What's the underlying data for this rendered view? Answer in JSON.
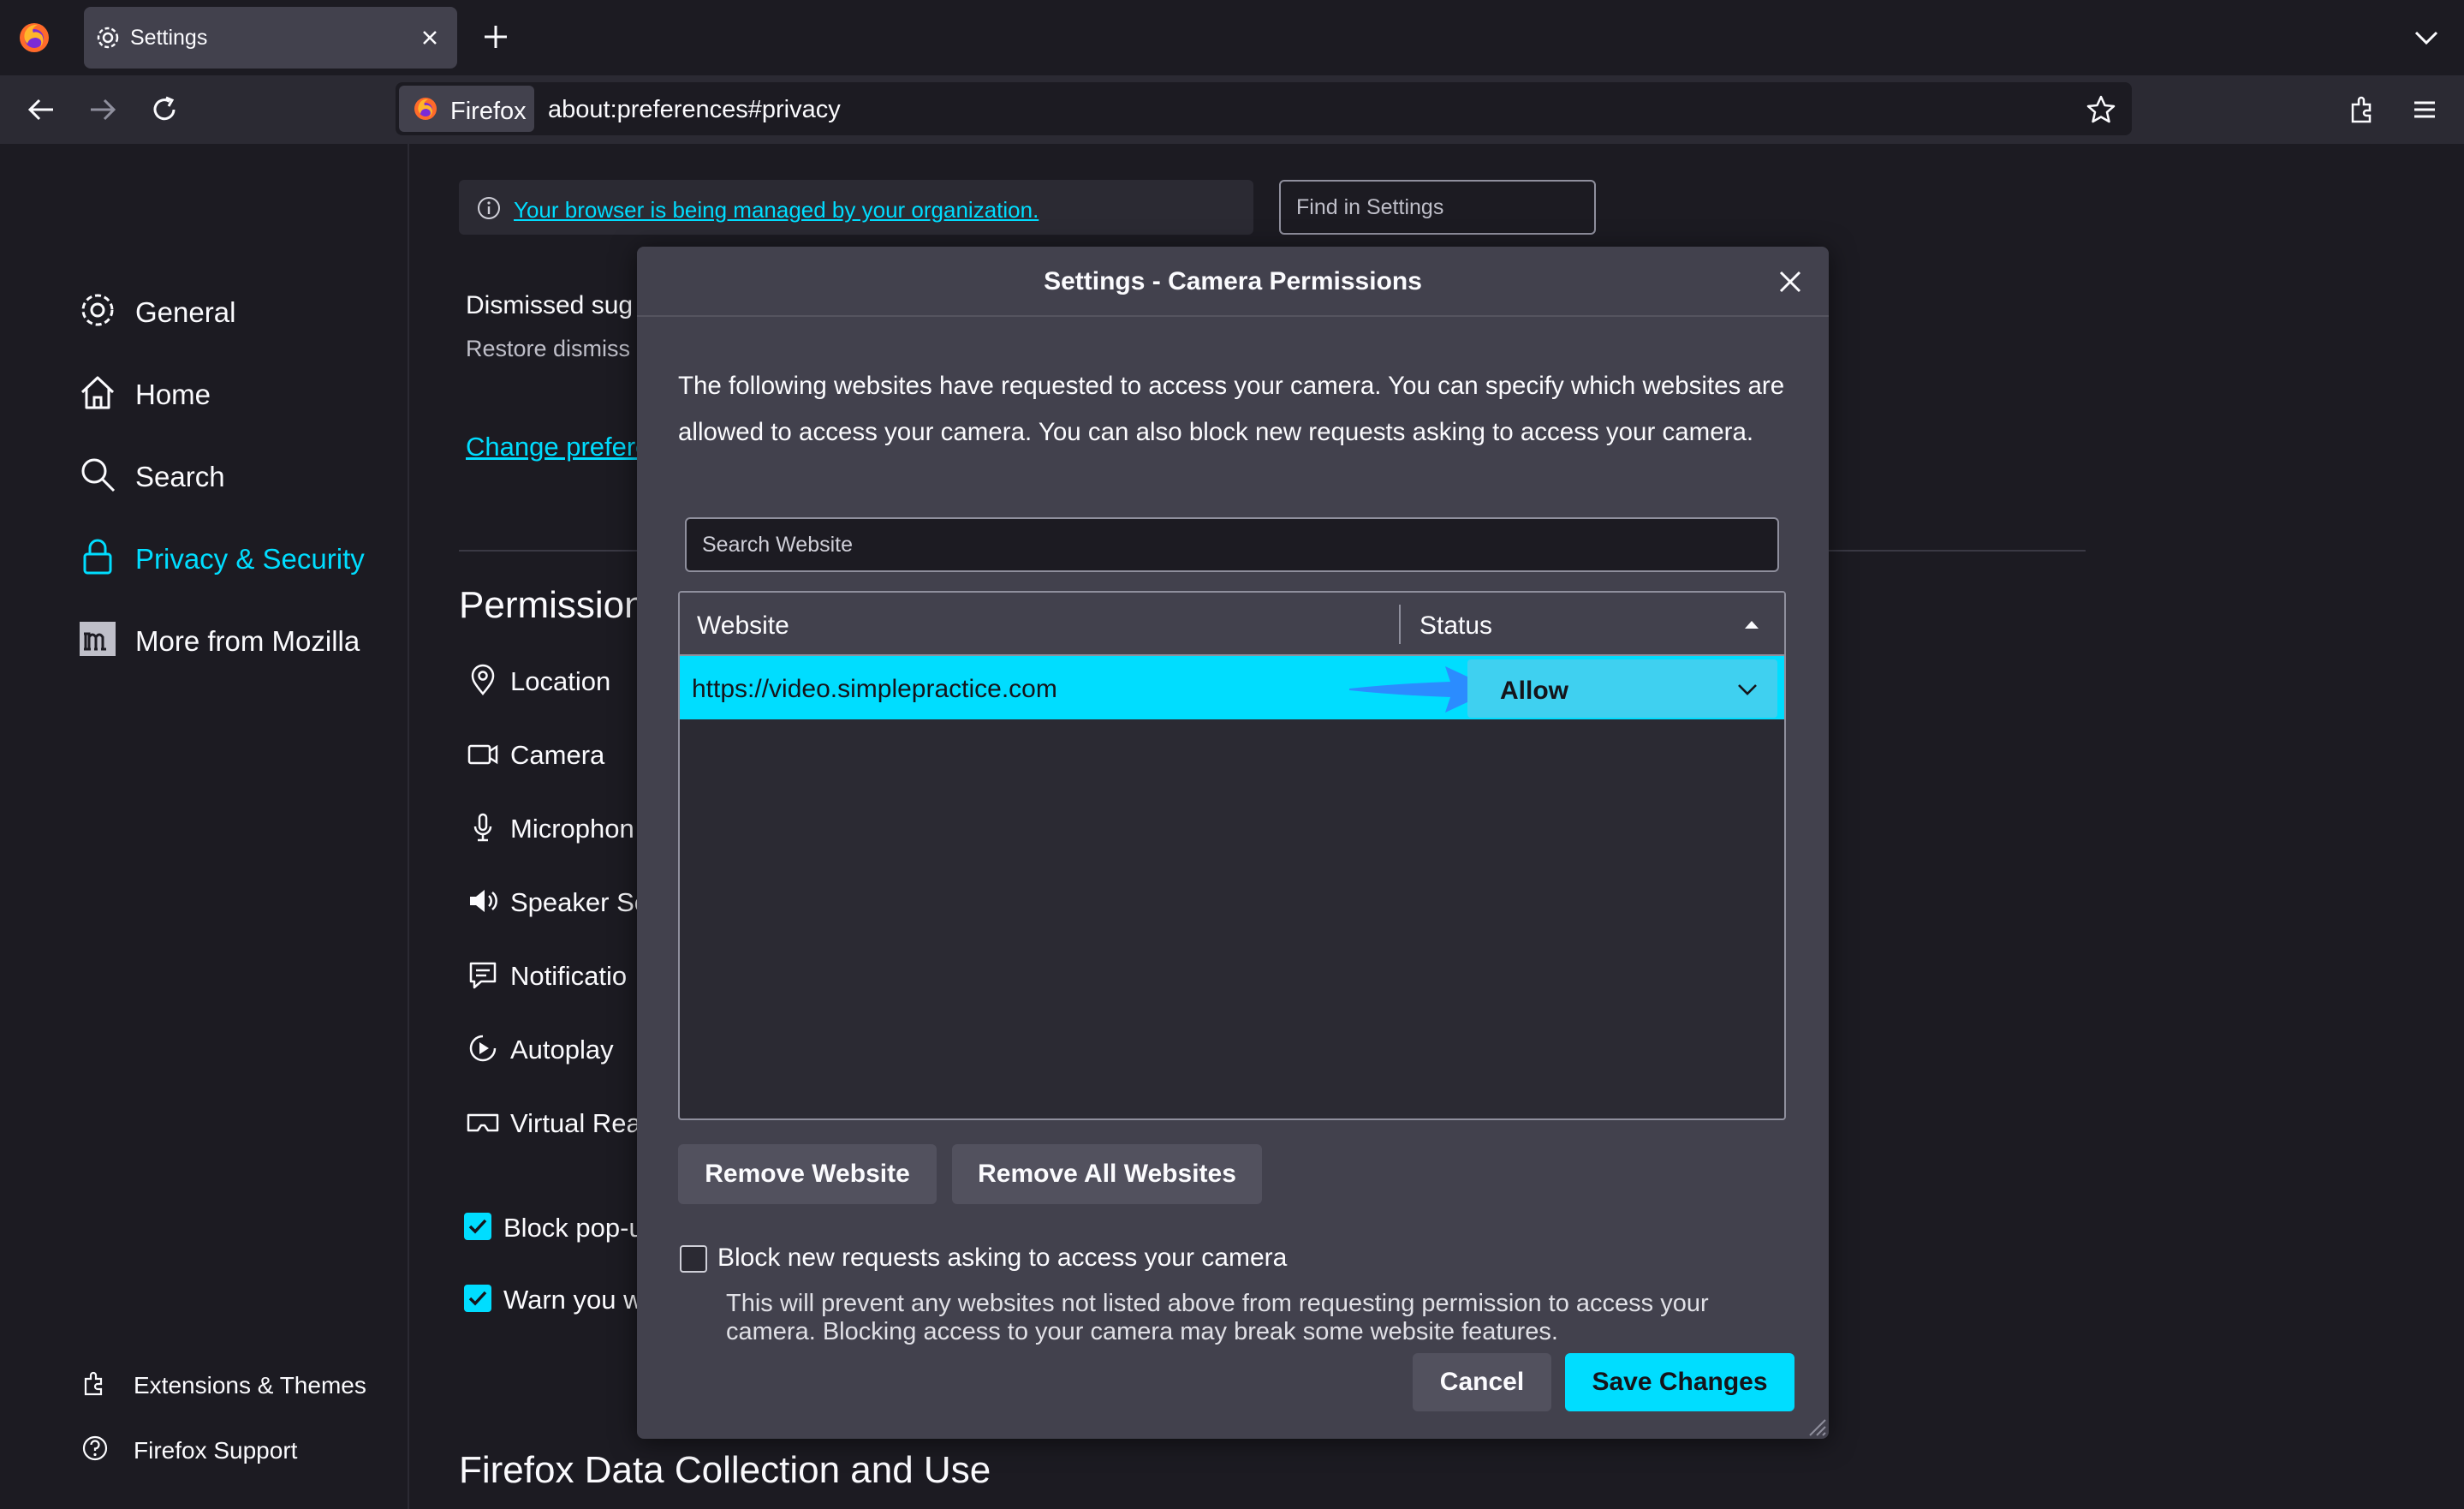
{
  "browser": {
    "tab_title": "Settings",
    "identity_label": "Firefox",
    "url": "about:preferences#privacy"
  },
  "sidebar": {
    "items": [
      {
        "label": "General",
        "icon": "gear-icon"
      },
      {
        "label": "Home",
        "icon": "home-icon"
      },
      {
        "label": "Search",
        "icon": "search-icon"
      },
      {
        "label": "Privacy & Security",
        "icon": "lock-icon",
        "selected": true
      },
      {
        "label": "More from Mozilla",
        "icon": "mozilla-icon"
      }
    ],
    "footer": [
      {
        "label": "Extensions & Themes",
        "icon": "extension-icon"
      },
      {
        "label": "Firefox Support",
        "icon": "help-icon"
      }
    ]
  },
  "main": {
    "managed_notice": "Your browser is being managed by your organization.",
    "find_placeholder": "Find in Settings",
    "dismissed_title": "Dismissed sug",
    "restore_text": "Restore dismiss",
    "change_prefs": "Change prefere",
    "permissions_heading": "Permissions",
    "permissions": [
      {
        "label": "Location",
        "icon": "location-icon"
      },
      {
        "label": "Camera",
        "icon": "camera-icon"
      },
      {
        "label": "Microphon",
        "icon": "microphone-icon"
      },
      {
        "label": "Speaker Se",
        "icon": "speaker-icon"
      },
      {
        "label": "Notificatio",
        "icon": "notification-icon"
      },
      {
        "label": "Autoplay",
        "icon": "autoplay-icon"
      },
      {
        "label": "Virtual Rea",
        "icon": "vr-icon"
      }
    ],
    "checkboxes": [
      {
        "label": "Block pop-u",
        "checked": true
      },
      {
        "label": "Warn you w",
        "checked": true
      }
    ],
    "data_heading": "Firefox Data Collection and Use"
  },
  "dialog": {
    "title": "Settings - Camera Permissions",
    "description": "The following websites have requested to access your camera. You can specify which websites are allowed to access your camera. You can also block new requests asking to access your camera.",
    "search_placeholder": "Search Website",
    "columns": {
      "website": "Website",
      "status": "Status"
    },
    "rows": [
      {
        "website": "https://video.simplepractice.com",
        "status": "Allow"
      }
    ],
    "remove_website": "Remove Website",
    "remove_all": "Remove All Websites",
    "block_label": "Block new requests asking to access your camera",
    "block_checked": false,
    "block_desc": "This will prevent any websites not listed above from requesting permission to access your camera. Blocking access to your camera may break some website features.",
    "cancel": "Cancel",
    "save": "Save Changes"
  },
  "colors": {
    "accent": "#00ddff",
    "background": "#1c1b22",
    "dialog": "#42414d",
    "annotation_arrow": "#2b8cff"
  }
}
